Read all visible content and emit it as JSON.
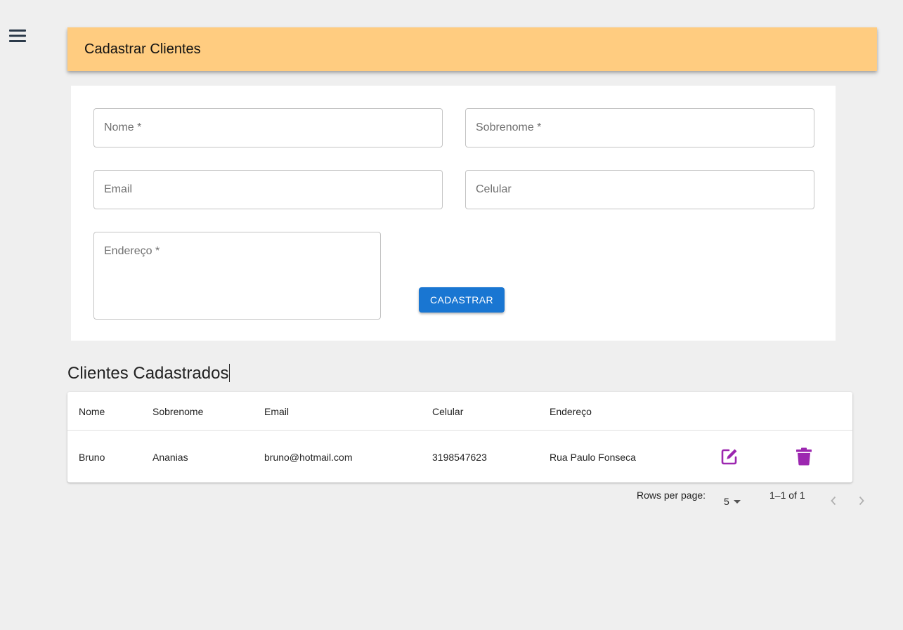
{
  "menu": {
    "icon": "hamburger-menu-icon"
  },
  "header": {
    "title": "Cadastrar Clientes"
  },
  "form": {
    "nome_label": "Nome *",
    "sobrenome_label": "Sobrenome *",
    "email_label": "Email",
    "celular_label": "Celular",
    "endereco_label": "Endereço *",
    "submit_label": "CADASTRAR"
  },
  "list": {
    "title": "Clientes Cadastrados",
    "columns": [
      "Nome",
      "Sobrenome",
      "Email",
      "Celular",
      "Endereço"
    ],
    "rows": [
      {
        "nome": "Bruno",
        "sobrenome": "Ananias",
        "email": "bruno@hotmail.com",
        "celular": "3198547623",
        "endereco": "Rua Paulo Fonseca",
        "edit_icon": "edit-icon",
        "delete_icon": "trash-icon"
      }
    ]
  },
  "pagination": {
    "rows_per_page_label": "Rows per page:",
    "rows_per_page_value": "5",
    "range_label": "1–1 of 1"
  },
  "colors": {
    "header_bg": "#ffcc80",
    "primary": "#1976d2",
    "action_icon": "#9c27b0",
    "page_bg": "#efefef"
  }
}
